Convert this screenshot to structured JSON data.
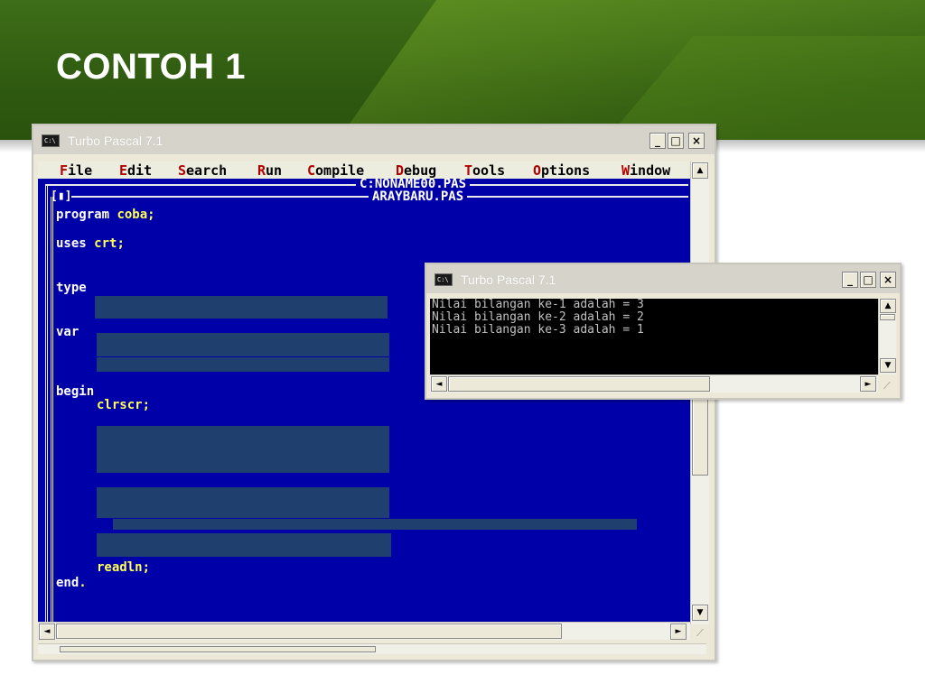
{
  "slide": {
    "title": "CONTOH 1"
  },
  "ide_window": {
    "title": "Turbo Pascal 7.1",
    "icon_text": "C:\\",
    "menu": [
      {
        "hotkey": "F",
        "rest": "ile"
      },
      {
        "hotkey": "E",
        "rest": "dit"
      },
      {
        "hotkey": "S",
        "rest": "earch"
      },
      {
        "hotkey": "R",
        "rest": "un"
      },
      {
        "hotkey": "C",
        "rest": "ompile"
      },
      {
        "hotkey": "D",
        "rest": "ebug"
      },
      {
        "hotkey": "T",
        "rest": "ools"
      },
      {
        "hotkey": "O",
        "rest": "ptions"
      },
      {
        "hotkey": "W",
        "rest": "indow"
      }
    ],
    "back_file": "C:NONAME00.PAS",
    "front_file": "ARAYBARU.PAS",
    "close_marker": "[▮]",
    "code": {
      "line_program_kw": "program ",
      "line_program_id": "coba;",
      "line_uses_kw": "uses ",
      "line_uses_id": "crt;",
      "line_type": "type",
      "line_var": "var",
      "line_begin": "begin",
      "line_clrscr": "clrscr;",
      "line_readln": "readln;",
      "line_end_kw": "end",
      "line_end_dot": "."
    }
  },
  "output_window": {
    "title": "Turbo Pascal 7.1",
    "icon_text": "C:\\",
    "lines": [
      "Nilai bilangan ke-1 adalah = 3",
      "Nilai bilangan ke-2 adalah = 2",
      "Nilai bilangan ke-3 adalah = 1"
    ]
  },
  "controls": {
    "minimize": "_",
    "maximize": "□",
    "close": "×"
  },
  "icons": {
    "window-app": "console-icon",
    "scroll-up": "▲",
    "scroll-down": "▼",
    "scroll-left": "◄",
    "scroll-right": "►"
  },
  "colors": {
    "editor_bg": "#0000a8",
    "identifier": "#ffff54",
    "menu_hotkey": "#b00000",
    "header_green": "#3e6e18"
  }
}
